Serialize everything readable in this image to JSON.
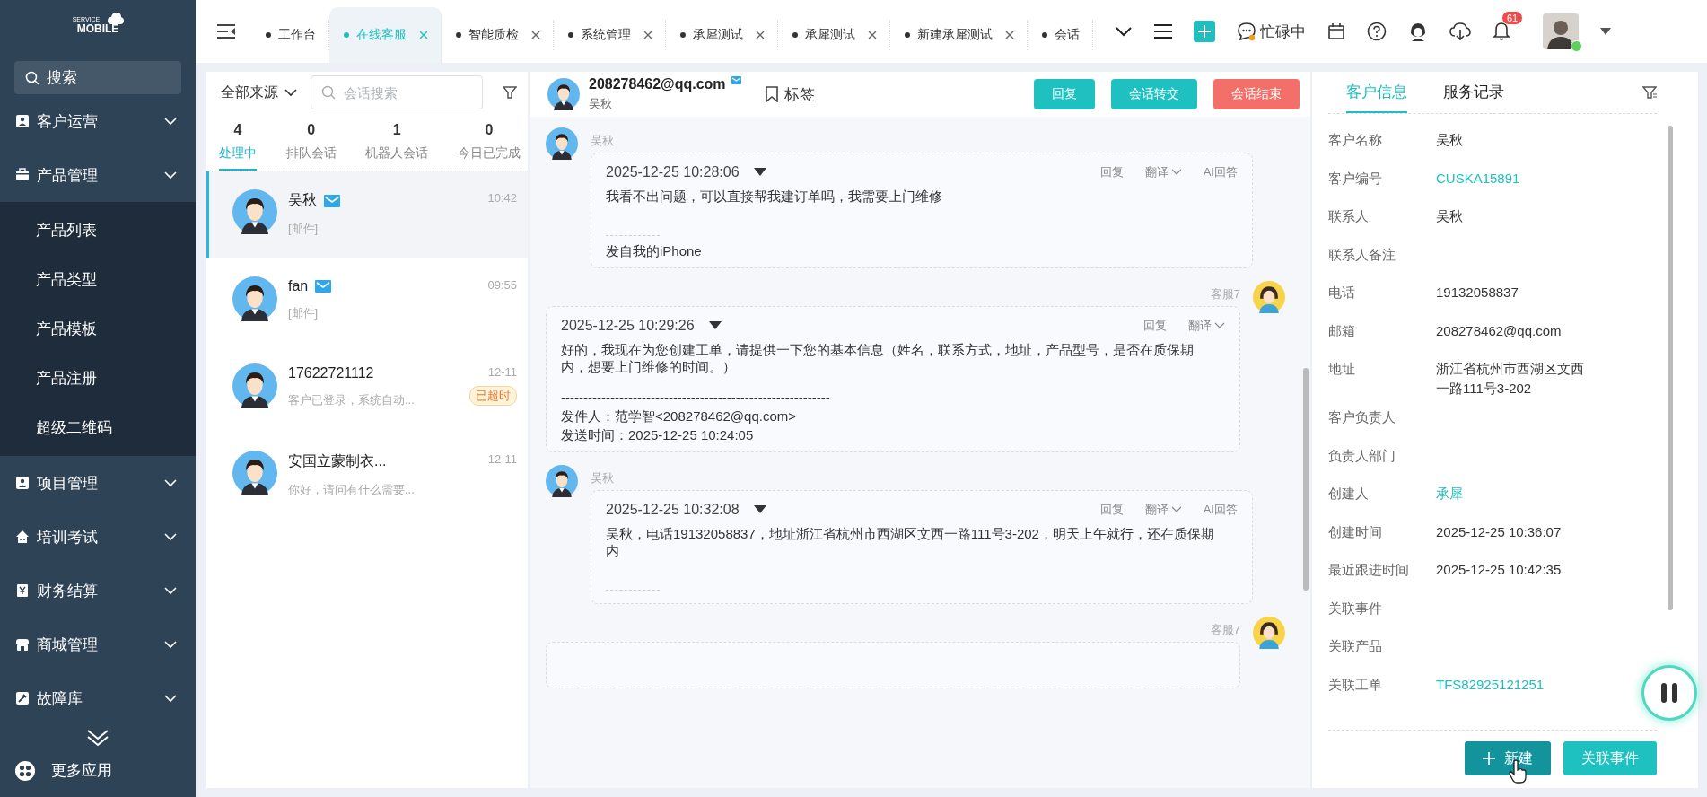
{
  "sidebar": {
    "logo": {
      "small": "SERVICE",
      "big": "MOBILE"
    },
    "search": {
      "placeholder": "搜索"
    },
    "menu": [
      {
        "label": "客户运营"
      },
      {
        "label": "产品管理",
        "children": [
          {
            "label": "产品列表"
          },
          {
            "label": "产品类型"
          },
          {
            "label": "产品模板"
          },
          {
            "label": "产品注册"
          },
          {
            "label": "超级二维码"
          }
        ]
      },
      {
        "label": "项目管理"
      },
      {
        "label": "培训考试"
      },
      {
        "label": "财务结算"
      },
      {
        "label": "商城管理"
      },
      {
        "label": "故障库"
      }
    ],
    "more_apps": "更多应用"
  },
  "topbar": {
    "tabs": [
      {
        "label": "工作台",
        "selected": false,
        "closable": false
      },
      {
        "label": "在线客服",
        "selected": true,
        "closable": true
      },
      {
        "label": "智能质检",
        "selected": false,
        "closable": true
      },
      {
        "label": "系统管理",
        "selected": false,
        "closable": true
      },
      {
        "label": "承犀测试",
        "selected": false,
        "closable": true
      },
      {
        "label": "承犀测试",
        "selected": false,
        "closable": true
      },
      {
        "label": "新建承犀测试",
        "selected": false,
        "closable": true
      },
      {
        "label": "会话",
        "selected": false,
        "closable": false
      }
    ],
    "status": "忙碌中",
    "notifications": "61",
    "user": {
      "online": true
    }
  },
  "conversations": {
    "source": "全部来源",
    "search": {
      "placeholder": "会话搜索"
    },
    "stats": [
      {
        "count": "4",
        "label": "处理中",
        "selected": true
      },
      {
        "count": "0",
        "label": "排队会话",
        "selected": false
      },
      {
        "count": "1",
        "label": "机器人会话",
        "selected": false
      },
      {
        "count": "0",
        "label": "今日已完成",
        "selected": false
      }
    ],
    "items": [
      {
        "name": "吴秋",
        "mail": true,
        "time": "10:42",
        "preview": "[邮件]",
        "selected": true
      },
      {
        "name": "fan",
        "mail": true,
        "time": "09:55",
        "preview": "[邮件]",
        "selected": false
      },
      {
        "name": "17622721112",
        "mail": false,
        "time": "12-11",
        "preview": "客户已登录，系统自动...",
        "badge": "已超时",
        "selected": false
      },
      {
        "name": "安国立蒙制衣...",
        "mail": false,
        "time": "12-11",
        "preview": "你好，请问有什么需要...",
        "selected": false
      }
    ]
  },
  "chat": {
    "header": {
      "title": "208278462@qq.com",
      "subtitle": "吴秋",
      "tag_label": "标签",
      "buttons": [
        {
          "label": "回复",
          "kind": "primary"
        },
        {
          "label": "会话转交",
          "kind": "primary"
        },
        {
          "label": "会话结束",
          "kind": "danger"
        }
      ]
    },
    "messages": [
      {
        "kind": "customer",
        "sender": "吴秋",
        "time": "2025-12-25 10:28:06",
        "actions": [
          {
            "label": "回复",
            "dropdown": false
          },
          {
            "label": "翻译",
            "dropdown": true
          },
          {
            "label": "AI回答",
            "dropdown": false
          }
        ],
        "body": "我看不出问题，可以直接帮我建订单吗，我需要上门维修",
        "signature": [
          "发自我的iPhone"
        ]
      },
      {
        "kind": "agent",
        "sender": "客服7",
        "time": "2025-12-25 10:29:26",
        "actions": [
          {
            "label": "回复",
            "dropdown": false
          },
          {
            "label": "翻译",
            "dropdown": true
          }
        ],
        "body": "好的，我现在为您创建工单，请提供一下您的基本信息（姓名，联系方式，地址，产品型号，是否在质保期内，想要上门维修的时间。）",
        "signature": [
          "------------------------------------------------------------",
          "发件人：范学智<208278462@qq.com>",
          "发送时间：2025-12-25 10:24:05"
        ]
      },
      {
        "kind": "customer",
        "sender": "吴秋",
        "time": "2025-12-25 10:32:08",
        "actions": [
          {
            "label": "回复",
            "dropdown": false
          },
          {
            "label": "翻译",
            "dropdown": true
          },
          {
            "label": "AI回答",
            "dropdown": false
          }
        ],
        "body": "吴秋，电话19132058837，地址浙江省杭州市西湖区文西一路111号3-202，明天上午就行，还在质保期内"
      },
      {
        "kind": "agent",
        "sender": "客服7"
      }
    ]
  },
  "customer_panel": {
    "tabs": [
      {
        "label": "客户信息",
        "selected": true
      },
      {
        "label": "服务记录",
        "selected": false
      }
    ],
    "fields": [
      {
        "label": "客户名称",
        "value": "吴秋",
        "link": false
      },
      {
        "label": "客户编号",
        "value": "CUSKA15891",
        "link": true
      },
      {
        "label": "联系人",
        "value": "吴秋",
        "link": false
      },
      {
        "label": "联系人备注"
      },
      {
        "label": "电话",
        "value": "19132058837",
        "link": false
      },
      {
        "label": "邮箱",
        "value": "208278462@qq.com",
        "link": false
      },
      {
        "label": "地址",
        "value": "浙江省杭州市西湖区文西一路111号3-202",
        "link": false
      },
      {
        "label": "客户负责人"
      },
      {
        "label": "负责人部门"
      },
      {
        "label": "创建人",
        "value": "承犀",
        "link": true
      },
      {
        "label": "创建时间",
        "value": "2025-12-25 10:36:07",
        "link": false
      },
      {
        "label": "最近跟进时间",
        "value": "2025-12-25 10:42:35",
        "link": false
      },
      {
        "label": "关联事件"
      },
      {
        "label": "关联产品"
      },
      {
        "label": "关联工单",
        "value": "TFS82925121251",
        "link": true
      }
    ],
    "buttons": [
      {
        "label": "新建",
        "kind": "create",
        "hovered": true
      },
      {
        "label": "关联事件",
        "kind": "plain",
        "hovered": false
      }
    ]
  }
}
